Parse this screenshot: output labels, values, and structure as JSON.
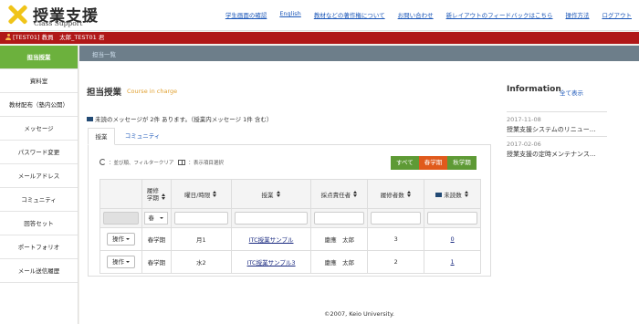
{
  "brand": {
    "title_jp": "授業支援",
    "title_en": "Class Support"
  },
  "top_links": [
    {
      "label": "学生画面の確認"
    },
    {
      "label": "English"
    },
    {
      "label": "教材などの著作権について"
    },
    {
      "label": "お問い合わせ"
    },
    {
      "label": "新レイアウトのフィードバックはこちら"
    },
    {
      "label": "操作方法"
    },
    {
      "label": "ログアウト"
    }
  ],
  "user_bar": {
    "text": "[TEST01] 教員　太郎_TEST01 君"
  },
  "sidebar": {
    "items": [
      {
        "label": "担当授業",
        "active": true
      },
      {
        "label": "資料室"
      },
      {
        "label": "教材配布（塾内公開）"
      },
      {
        "label": "メッセージ"
      },
      {
        "label": "パスワード変更"
      },
      {
        "label": "メールアドレス"
      },
      {
        "label": "コミュニティ"
      },
      {
        "label": "回答セット"
      },
      {
        "label": "ポートフォリオ"
      },
      {
        "label": "メール送信履歴"
      }
    ]
  },
  "breadcrumb": "担当一覧",
  "page": {
    "title": "担当授業",
    "subtitle": "Course in charge",
    "message_line": "未読のメッセージが 2件 あります。（授業内メッセージ 1件 含む）"
  },
  "tabs": [
    {
      "label": "授業"
    },
    {
      "label": "コミュニティ"
    }
  ],
  "controls": {
    "reset_label": "：並び順、フィルタークリア",
    "columns_label": "：表示項目選択"
  },
  "filters": [
    {
      "label": "すべて"
    },
    {
      "label": "春学期",
      "active": true
    },
    {
      "label": "秋学期"
    }
  ],
  "table": {
    "headers": [
      "",
      "履修学期",
      "曜日/時限",
      "授業",
      "採点責任者",
      "履修者数",
      "未読数"
    ],
    "filter_select": "春",
    "rows": [
      {
        "op": "操作",
        "term": "春学期",
        "time": "月1",
        "course": "ITC授業サンプル",
        "grader": "慶應　太郎",
        "count": "3",
        "unread": "0"
      },
      {
        "op": "操作",
        "term": "春学期",
        "time": "水2",
        "course": "ITC授業サンプル3",
        "grader": "慶應　太郎",
        "count": "2",
        "unread": "1"
      }
    ]
  },
  "info": {
    "title": "Information",
    "view_all": "全て表示",
    "items": [
      {
        "date": "2017-11-08",
        "text": "授業支援システムのリニュー..."
      },
      {
        "date": "2017-02-06",
        "text": "授業支援の定時メンテナンス..."
      }
    ]
  },
  "footer": "©2007, Keio University."
}
